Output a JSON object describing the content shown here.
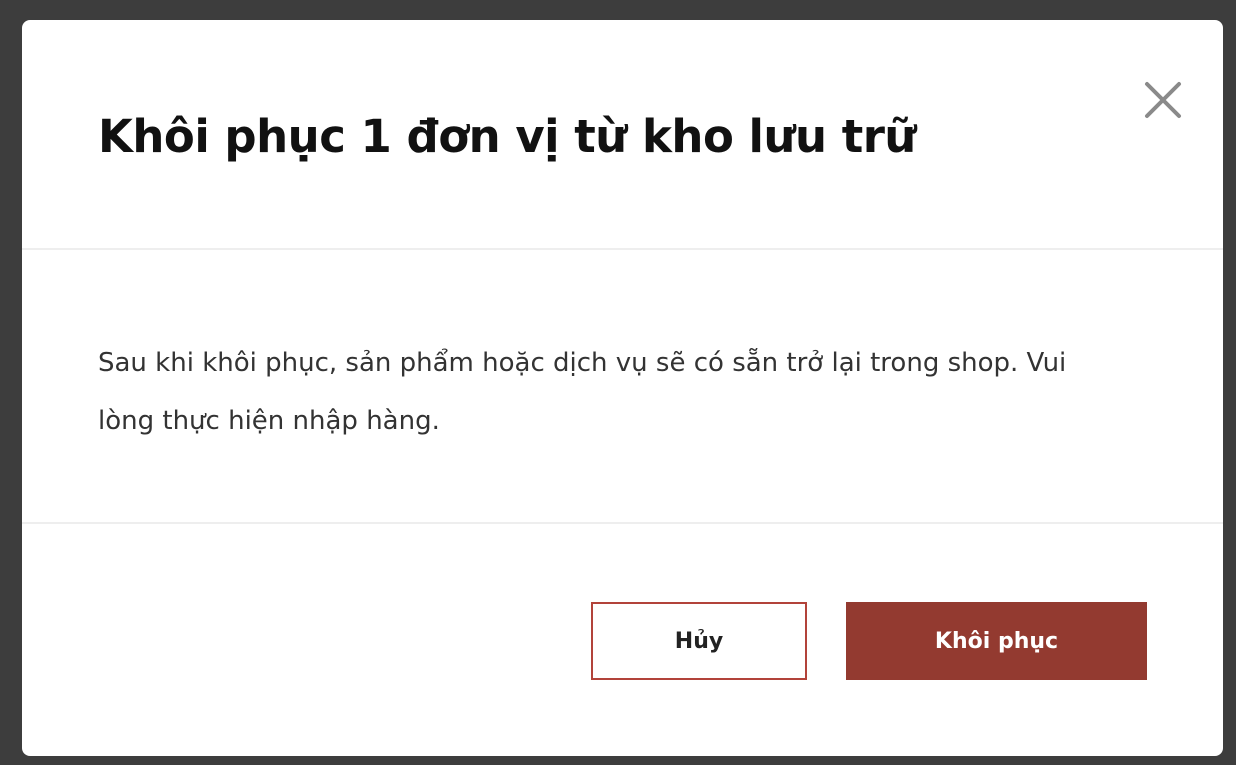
{
  "dialog": {
    "title": "Khôi phục 1 đơn vị từ kho lưu trữ",
    "message": "Sau khi khôi phục, sản phẩm hoặc dịch vụ sẽ có sẵn trở lại trong shop. Vui lòng thực hiện nhập hàng.",
    "close_icon": "close-icon",
    "buttons": {
      "cancel_label": "Hủy",
      "confirm_label": "Khôi phục"
    }
  },
  "colors": {
    "overlay": "#3d3d3d",
    "accent": "#933a30",
    "cancel_border": "#b2433a"
  }
}
